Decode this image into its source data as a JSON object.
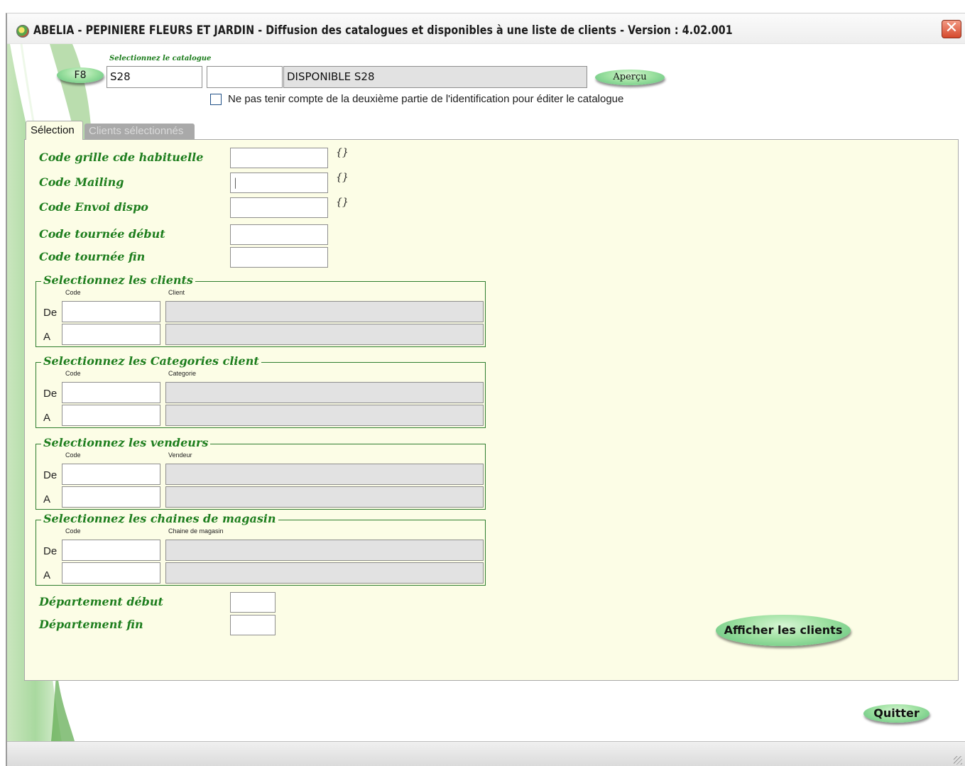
{
  "window": {
    "title": "ABELIA  -  PEPINIERE FLEURS ET JARDIN  -  Diffusion des catalogues et disponibles à une liste de clients  -  Version : 4.02.001",
    "close_label": "✕"
  },
  "catalogue": {
    "section_label": "Selectionnez le catalogue",
    "f8_label": "F8",
    "code": "S28",
    "code2": "",
    "description": "DISPONIBLE S28",
    "preview_label": "Aperçu",
    "ignore_second_part_label": "Ne pas tenir compte de la deuxième partie de l'identification pour éditer le catalogue",
    "ignore_second_part_checked": false
  },
  "tabs": [
    {
      "label": "Sélection",
      "active": true
    },
    {
      "label": "Clients sélectionnés",
      "active": false
    }
  ],
  "selection": {
    "fields": [
      {
        "label": "Code grille cde habituelle",
        "value": "",
        "brace": "{}"
      },
      {
        "label": "Code Mailing",
        "value": "|",
        "brace": "{}"
      },
      {
        "label": "Code Envoi dispo",
        "value": "",
        "brace": "{}"
      },
      {
        "label": "Code tournée début",
        "value": ""
      },
      {
        "label": "Code tournée fin",
        "value": ""
      }
    ],
    "groups": [
      {
        "title": "Selectionnez les clients",
        "col_code": "Code",
        "col_name": "Client",
        "rows": [
          {
            "label": "De",
            "code": "",
            "name": ""
          },
          {
            "label": "A",
            "code": "",
            "name": ""
          }
        ]
      },
      {
        "title": "Selectionnez les Categories client",
        "col_code": "Code",
        "col_name": "Categorie",
        "rows": [
          {
            "label": "De",
            "code": "",
            "name": ""
          },
          {
            "label": "A",
            "code": "",
            "name": ""
          }
        ]
      },
      {
        "title": "Selectionnez les vendeurs",
        "col_code": "Code",
        "col_name": "Vendeur",
        "rows": [
          {
            "label": "De",
            "code": "",
            "name": ""
          },
          {
            "label": "A",
            "code": "",
            "name": ""
          }
        ]
      },
      {
        "title": "Selectionnez les chaines de magasin",
        "col_code": "Code",
        "col_name": "Chaine de magasin",
        "rows": [
          {
            "label": "De",
            "code": "",
            "name": ""
          },
          {
            "label": "A",
            "code": "",
            "name": ""
          }
        ]
      }
    ],
    "departement_debut_label": "Département début",
    "departement_debut": "",
    "departement_fin_label": "Département fin",
    "departement_fin": "",
    "show_clients_label": "Afficher les clients"
  },
  "footer": {
    "quit_label": "Quitter"
  }
}
